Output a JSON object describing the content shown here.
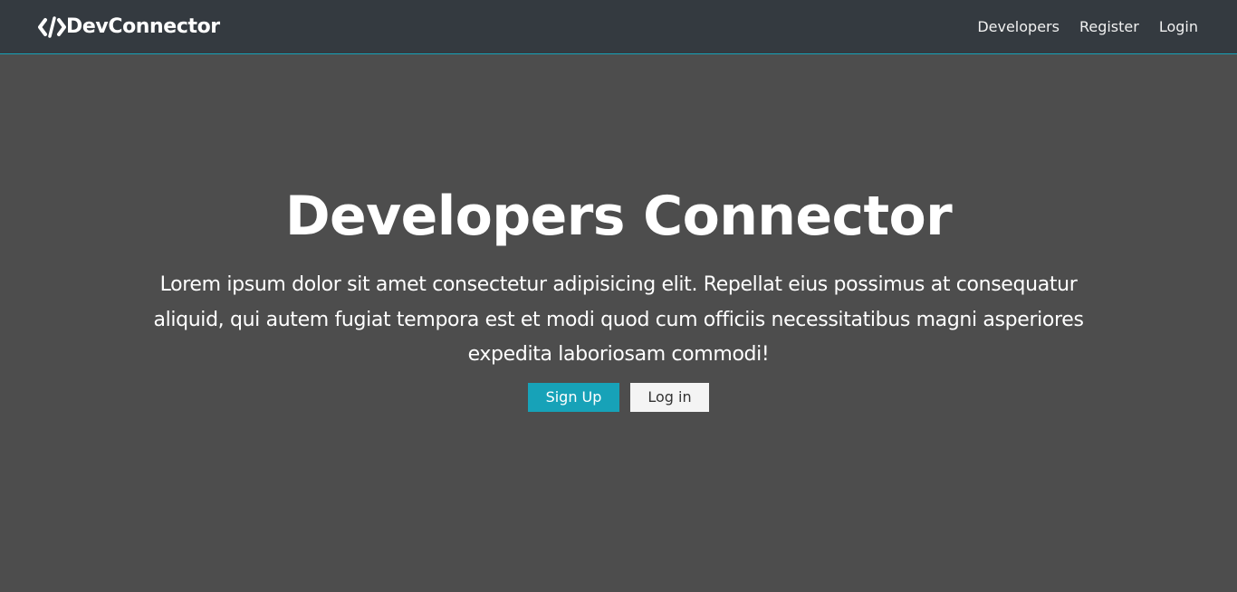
{
  "navbar": {
    "brand": "DevConnector",
    "brand_icon": "code-icon",
    "links": [
      "Developers",
      "Register",
      "Login"
    ]
  },
  "hero": {
    "title": "Developers Connector",
    "description": "Lorem ipsum dolor sit amet consectetur adipisicing elit. Repellat eius possimus at consequatur aliquid, qui autem fugiat tempora est et modi quod cum officiis necessitatibus magni asperiores expedita laboriosam commodi!",
    "buttons": {
      "sign_up": "Sign Up",
      "log_in": "Log in"
    }
  },
  "colors": {
    "page_background": "#4d4d4d",
    "navbar_background": "#343a40",
    "accent": "#17a2b8",
    "light_button": "#f4f4f4"
  }
}
